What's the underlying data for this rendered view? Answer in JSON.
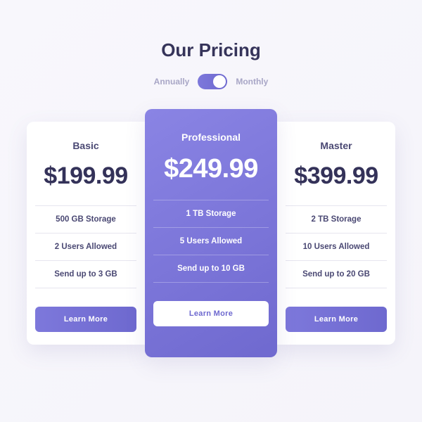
{
  "heading": "Our Pricing",
  "toggle": {
    "left_label": "Annually",
    "right_label": "Monthly",
    "state": "monthly"
  },
  "tiers": [
    {
      "name": "Basic",
      "price": "$199.99",
      "features": [
        "500 GB Storage",
        "2 Users Allowed",
        "Send up to 3 GB"
      ],
      "cta": "Learn More"
    },
    {
      "name": "Professional",
      "price": "$249.99",
      "features": [
        "1 TB Storage",
        "5 Users Allowed",
        "Send up to 10 GB"
      ],
      "cta": "Learn More",
      "featured": true
    },
    {
      "name": "Master",
      "price": "$399.99",
      "features": [
        "2 TB Storage",
        "10 Users Allowed",
        "Send up to 20 GB"
      ],
      "cta": "Learn More"
    }
  ],
  "colors": {
    "accent_start": "#8a84e4",
    "accent_end": "#6f69cf",
    "text_dark": "#36345a"
  }
}
